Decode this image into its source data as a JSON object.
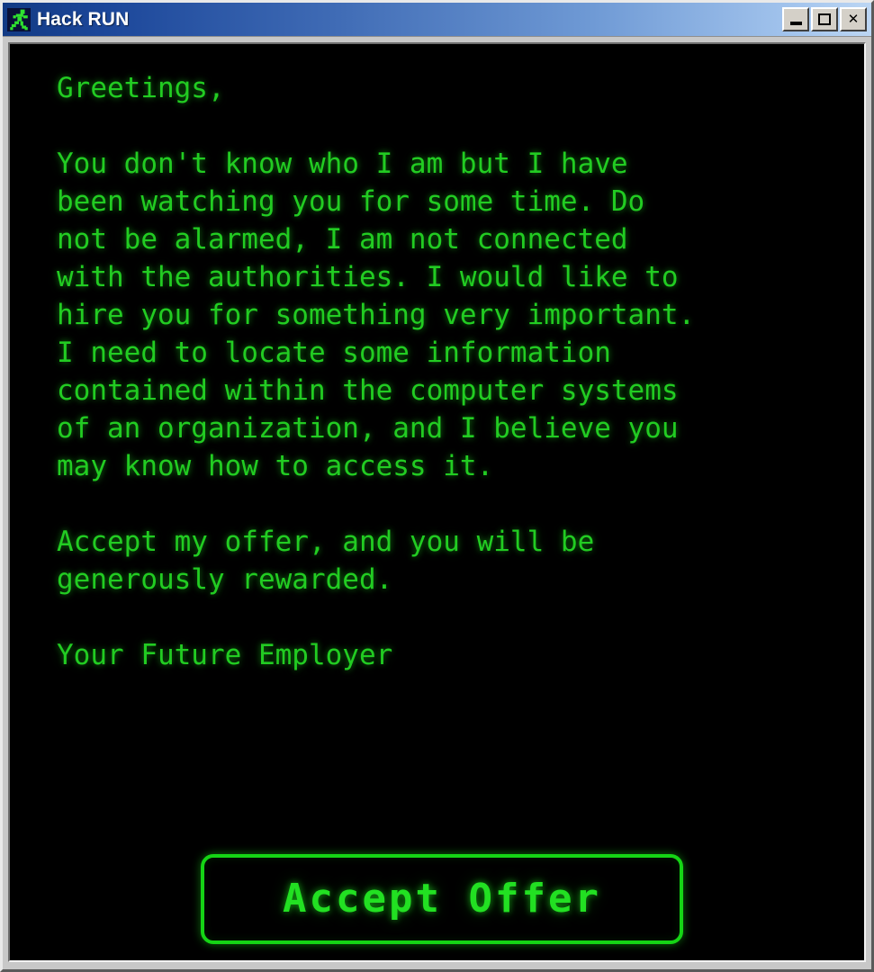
{
  "window": {
    "title": "Hack RUN",
    "icon": "running-man-icon",
    "controls": {
      "minimize_label": "_",
      "maximize_label": "□",
      "close_label": "✕"
    }
  },
  "terminal": {
    "background_color": "#000000",
    "text_color": "#22cc22",
    "lines": [
      "Greetings,",
      "",
      "You don't know who I am but I have",
      "been watching you for some time. Do",
      "not be alarmed, I am not connected",
      "with the authorities. I would like to",
      "hire you for something very important.",
      "I need to locate some information",
      "contained within the computer systems",
      "of an organization, and I believe you",
      "may know how to access it.",
      "",
      "Accept my offer, and you will be",
      "generously rewarded.",
      "",
      "Your Future Employer"
    ]
  },
  "actions": {
    "accept_offer_label": "Accept Offer",
    "accept_offer_color": "#15d415"
  }
}
